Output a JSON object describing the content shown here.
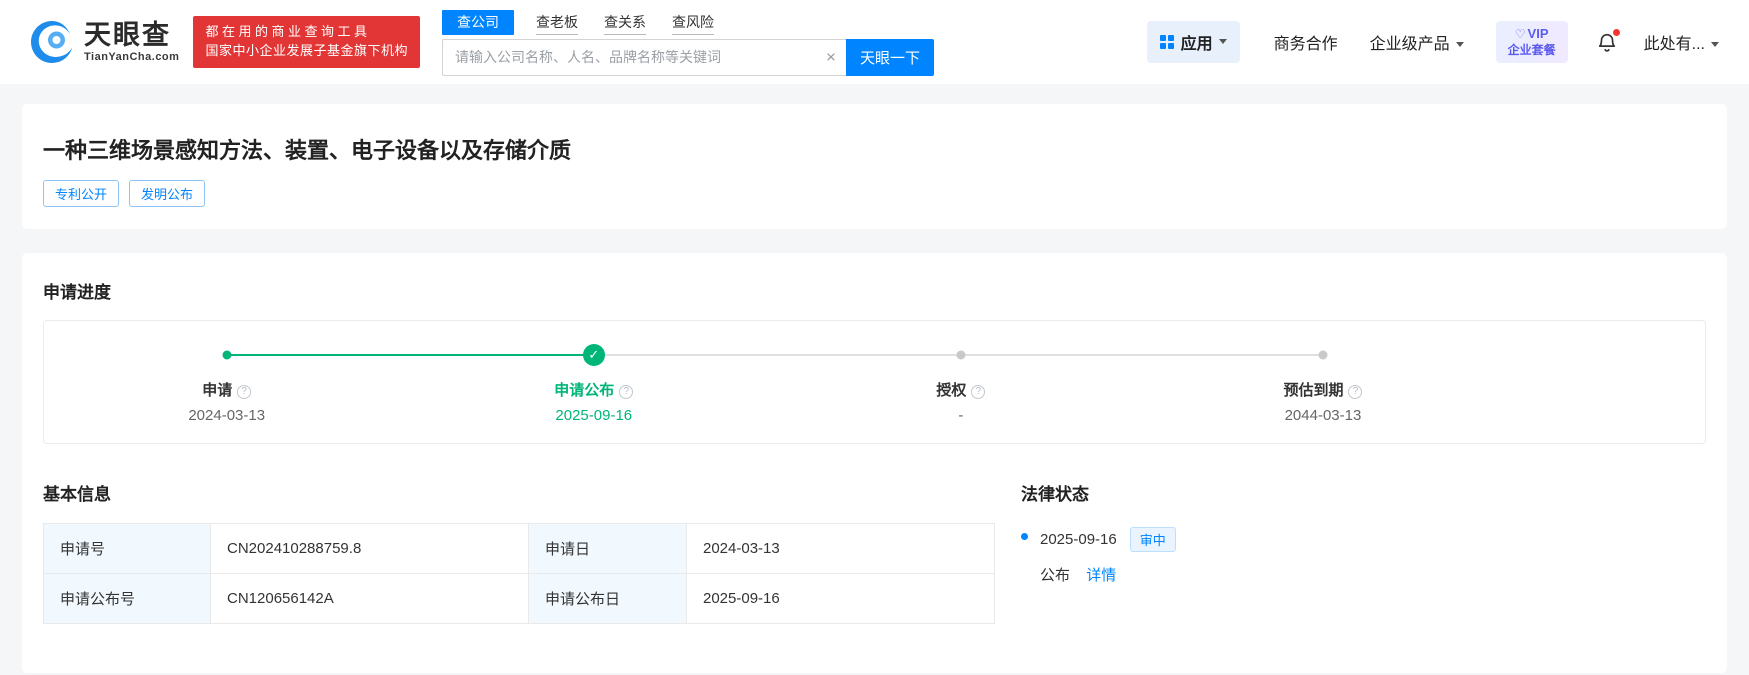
{
  "icons": {
    "clear": "×",
    "check": "✓",
    "help": "?",
    "heart": "♡"
  },
  "colors": {
    "brand_blue": "#0084ff",
    "brand_red": "#e23636",
    "progress_green": "#00b578"
  },
  "header": {
    "logo": {
      "brand": "天眼查",
      "domain": "TianYanCha.com"
    },
    "slogan": {
      "line1": "都在用的商业查询工具",
      "line2": "国家中小企业发展子基金旗下机构"
    },
    "tabs": [
      {
        "label": "查公司"
      },
      {
        "label": "查老板"
      },
      {
        "label": "查关系"
      },
      {
        "label": "查风险"
      }
    ],
    "search": {
      "placeholder": "请输入公司名称、人名、品牌名称等关键词",
      "button": "天眼一下"
    },
    "nav": {
      "apps": "应用",
      "business": "商务合作",
      "enterprise": "企业级产品",
      "vip_line1": "VIP",
      "vip_line2": "企业套餐",
      "more": "此处有..."
    }
  },
  "patent": {
    "title": "一种三维场景感知方法、装置、电子设备以及存储介质",
    "tags": [
      {
        "label": "专利公开"
      },
      {
        "label": "发明公布"
      }
    ]
  },
  "progress": {
    "title": "申请进度",
    "steps": [
      {
        "label": "申请",
        "date": "2024-03-13"
      },
      {
        "label": "申请公布",
        "date": "2025-09-16"
      },
      {
        "label": "授权",
        "date": "-"
      },
      {
        "label": "预估到期",
        "date": "2044-03-13"
      }
    ]
  },
  "basic_info": {
    "title": "基本信息",
    "rows": [
      {
        "label1": "申请号",
        "value1": "CN202410288759.8",
        "label2": "申请日",
        "value2": "2024-03-13"
      },
      {
        "label1": "申请公布号",
        "value1": "CN120656142A",
        "label2": "申请公布日",
        "value2": "2025-09-16"
      }
    ]
  },
  "legal_status": {
    "title": "法律状态",
    "items": [
      {
        "date": "2025-09-16",
        "badge": "审中",
        "event": "公布",
        "link": "详情"
      }
    ]
  }
}
